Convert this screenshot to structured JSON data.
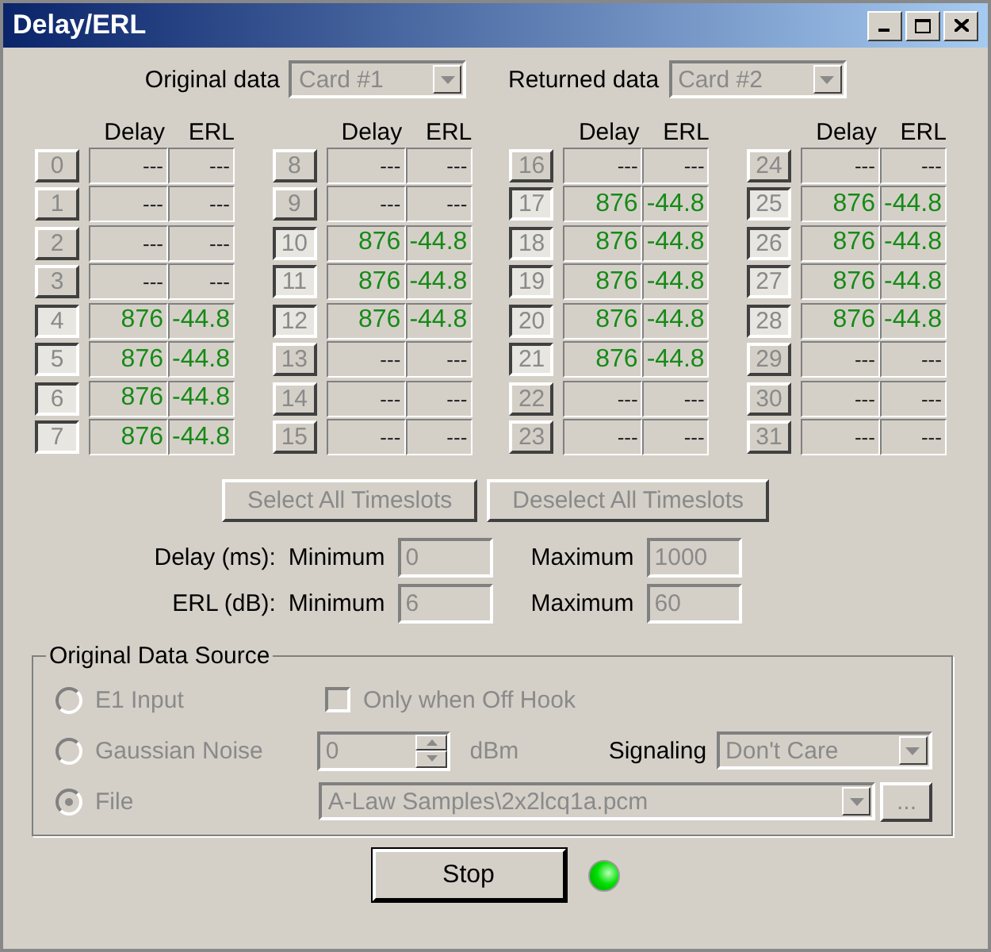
{
  "window": {
    "title": "Delay/ERL"
  },
  "card_selectors": [
    {
      "label": "Original data",
      "value": "Card #1"
    },
    {
      "label": "Returned data",
      "value": "Card #2"
    }
  ],
  "timeslot_groups": [
    {
      "headers": [
        "Delay",
        "ERL"
      ],
      "rows": [
        {
          "number": "0",
          "selected": false,
          "delay": "---",
          "erl": "---"
        },
        {
          "number": "1",
          "selected": false,
          "delay": "---",
          "erl": "---"
        },
        {
          "number": "2",
          "selected": false,
          "delay": "---",
          "erl": "---"
        },
        {
          "number": "3",
          "selected": false,
          "delay": "---",
          "erl": "---"
        },
        {
          "number": "4",
          "selected": true,
          "delay": "876",
          "erl": "-44.8"
        },
        {
          "number": "5",
          "selected": true,
          "delay": "876",
          "erl": "-44.8"
        },
        {
          "number": "6",
          "selected": true,
          "delay": "876",
          "erl": "-44.8"
        },
        {
          "number": "7",
          "selected": true,
          "delay": "876",
          "erl": "-44.8"
        }
      ]
    },
    {
      "headers": [
        "Delay",
        "ERL"
      ],
      "rows": [
        {
          "number": "8",
          "selected": false,
          "delay": "---",
          "erl": "---"
        },
        {
          "number": "9",
          "selected": false,
          "delay": "---",
          "erl": "---"
        },
        {
          "number": "10",
          "selected": true,
          "delay": "876",
          "erl": "-44.8"
        },
        {
          "number": "11",
          "selected": true,
          "delay": "876",
          "erl": "-44.8"
        },
        {
          "number": "12",
          "selected": true,
          "delay": "876",
          "erl": "-44.8"
        },
        {
          "number": "13",
          "selected": false,
          "delay": "---",
          "erl": "---"
        },
        {
          "number": "14",
          "selected": false,
          "delay": "---",
          "erl": "---"
        },
        {
          "number": "15",
          "selected": false,
          "delay": "---",
          "erl": "---"
        }
      ]
    },
    {
      "headers": [
        "Delay",
        "ERL"
      ],
      "rows": [
        {
          "number": "16",
          "selected": false,
          "delay": "---",
          "erl": "---"
        },
        {
          "number": "17",
          "selected": true,
          "delay": "876",
          "erl": "-44.8"
        },
        {
          "number": "18",
          "selected": true,
          "delay": "876",
          "erl": "-44.8"
        },
        {
          "number": "19",
          "selected": true,
          "delay": "876",
          "erl": "-44.8"
        },
        {
          "number": "20",
          "selected": true,
          "delay": "876",
          "erl": "-44.8"
        },
        {
          "number": "21",
          "selected": true,
          "delay": "876",
          "erl": "-44.8"
        },
        {
          "number": "22",
          "selected": false,
          "delay": "---",
          "erl": "---"
        },
        {
          "number": "23",
          "selected": false,
          "delay": "---",
          "erl": "---"
        }
      ]
    },
    {
      "headers": [
        "Delay",
        "ERL"
      ],
      "rows": [
        {
          "number": "24",
          "selected": false,
          "delay": "---",
          "erl": "---"
        },
        {
          "number": "25",
          "selected": true,
          "delay": "876",
          "erl": "-44.8"
        },
        {
          "number": "26",
          "selected": true,
          "delay": "876",
          "erl": "-44.8"
        },
        {
          "number": "27",
          "selected": true,
          "delay": "876",
          "erl": "-44.8"
        },
        {
          "number": "28",
          "selected": true,
          "delay": "876",
          "erl": "-44.8"
        },
        {
          "number": "29",
          "selected": false,
          "delay": "---",
          "erl": "---"
        },
        {
          "number": "30",
          "selected": false,
          "delay": "---",
          "erl": "---"
        },
        {
          "number": "31",
          "selected": false,
          "delay": "---",
          "erl": "---"
        }
      ]
    }
  ],
  "timeslot_buttons": [
    "Select All Timeslots",
    "Deselect All Timeslots"
  ],
  "limits": [
    {
      "label": "Delay (ms):",
      "min_label": "Minimum",
      "min": "0",
      "max_label": "Maximum",
      "max": "1000"
    },
    {
      "label": "ERL (dB):",
      "min_label": "Minimum",
      "min": "6",
      "max_label": "Maximum",
      "max": "60"
    }
  ],
  "source": {
    "title": "Original Data Source",
    "options": [
      {
        "label": "E1 Input",
        "selected": false
      },
      {
        "label": "Gaussian Noise",
        "selected": false
      },
      {
        "label": "File",
        "selected": true
      }
    ],
    "off_hook": {
      "label": "Only when Off Hook",
      "checked": false
    },
    "noise": {
      "value": "0",
      "unit": "dBm"
    },
    "signaling": {
      "label": "Signaling",
      "value": "Don't Care"
    },
    "file": {
      "value": "A-Law Samples\\2x2lcq1a.pcm",
      "browse": "..."
    }
  },
  "stop_button": "Stop",
  "indicator": {
    "on": true
  }
}
